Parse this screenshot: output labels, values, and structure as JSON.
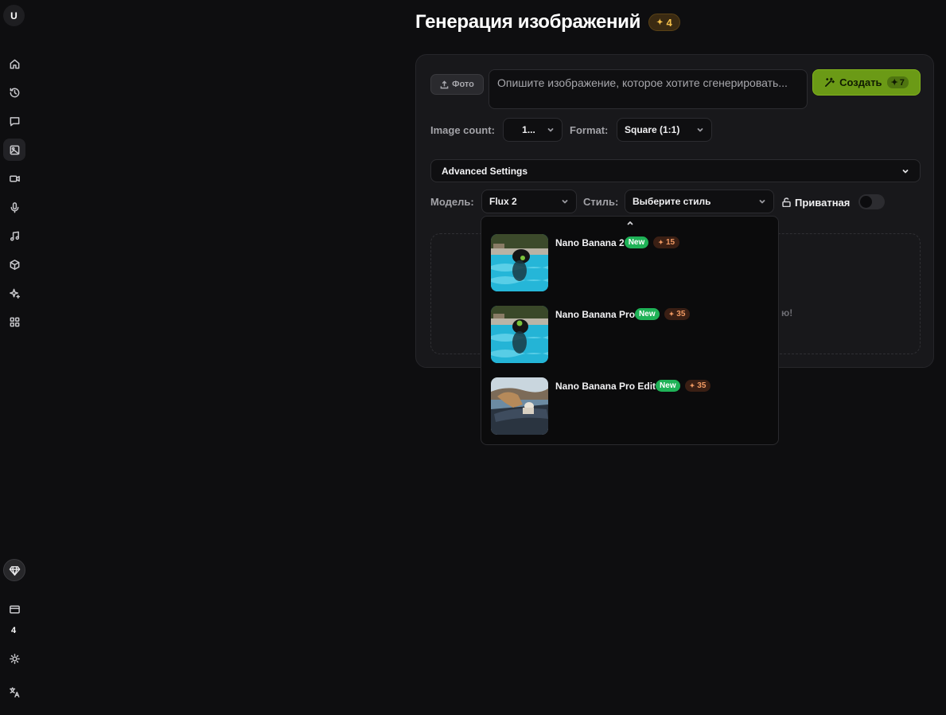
{
  "app": {
    "logo_letter": "U",
    "credits": "4"
  },
  "sidebar": {
    "items": [
      {
        "icon": "home-icon"
      },
      {
        "icon": "history-icon"
      },
      {
        "icon": "chat-icon"
      },
      {
        "icon": "image-icon",
        "active": true
      },
      {
        "icon": "video-icon"
      },
      {
        "icon": "microphone-icon"
      },
      {
        "icon": "music-icon"
      },
      {
        "icon": "cube-icon"
      },
      {
        "icon": "sparkles-icon"
      },
      {
        "icon": "apps-grid-icon"
      }
    ],
    "bottom": [
      "diamond-icon",
      "card-icon",
      "sun-icon",
      "translate-icon"
    ]
  },
  "header": {
    "title": "Генерация изображений",
    "credits_badge": "4"
  },
  "composer": {
    "photo_label": "Фото",
    "prompt_placeholder": "Опишите изображение, которое хотите сгенерировать...",
    "create_label": "Создать",
    "create_cost": "7",
    "image_count_label": "Image count:",
    "image_count_value": "1...",
    "format_label": "Format:",
    "format_value": "Square (1:1)",
    "advanced_label": "Advanced Settings",
    "model_label": "Модель:",
    "model_value": "Flux 2",
    "style_label": "Стиль:",
    "style_value": "Выберите стиль",
    "private_label": "Приватная",
    "private_enabled": false,
    "dropzone_text_fragment": "ю!"
  },
  "model_dropdown": {
    "items": [
      {
        "name": "Nano Banana 2",
        "badge": "New",
        "cost": "15"
      },
      {
        "name": "Nano Banana Pro",
        "badge": "New",
        "cost": "35"
      },
      {
        "name": "Nano Banana Pro Edit",
        "badge": "New",
        "cost": "35"
      }
    ]
  },
  "colors": {
    "background": "#0e0e10",
    "panel": "#18181b",
    "accent_green": "#6b9a16",
    "new_badge": "#1fb257",
    "cost_text": "#f29a63",
    "gold": "#f5c04a"
  }
}
